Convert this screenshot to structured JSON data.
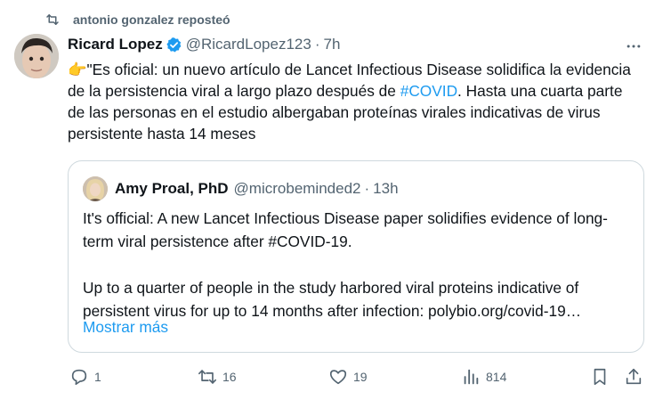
{
  "repost_banner": {
    "text": "antonio gonzalez reposteó",
    "icon": "repost-icon"
  },
  "tweet": {
    "author_name": "Ricard Lopez",
    "verified_icon": "verified-badge-icon",
    "handle": "@RicardLopez123",
    "separator": "·",
    "time": "7h",
    "more_icon": "more-options-icon",
    "text_part1": "👉\"Es oficial: un nuevo artículo de Lancet Infectious Disease solidifica la evidencia de la persistencia viral a largo plazo después de ",
    "hashtag": "#COVID",
    "text_part2": ".  Hasta una cuarta parte de las personas en el estudio albergaban proteínas virales indicativas de virus persistente hasta 14 meses"
  },
  "quote": {
    "author_name": "Amy Proal, PhD",
    "handle": "@microbeminded2",
    "separator": "·",
    "time": "13h",
    "paragraph1": "It's official: A new Lancet Infectious Disease paper solidifies evidence of long-term viral persistence after #COVID-19.",
    "paragraph2": "Up to a quarter of people in the study harbored viral proteins indicative of persistent virus for up to 14 months after infection: polybio.org/covid-19…",
    "show_more": "Mostrar más"
  },
  "actions": {
    "reply_count": "1",
    "repost_count": "16",
    "like_count": "19",
    "views_count": "814"
  },
  "colors": {
    "accent": "#1d9bf0",
    "text": "#0f1419",
    "secondary": "#536471",
    "border": "#cfd9de"
  }
}
